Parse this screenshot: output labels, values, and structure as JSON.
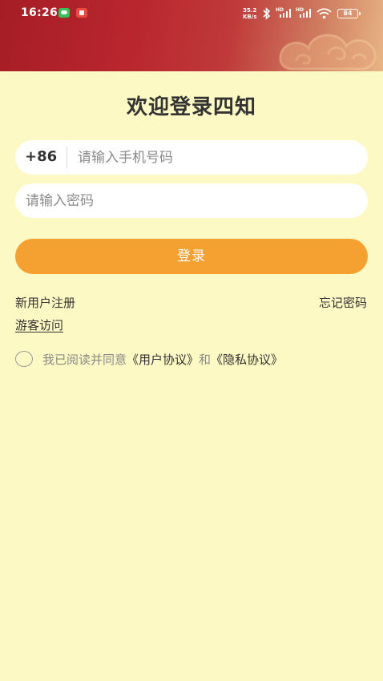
{
  "status_bar": {
    "time": "16:26",
    "net_speed_value": "35.2",
    "net_speed_unit": "KB/s",
    "signal_label": "HD",
    "battery": "84"
  },
  "login": {
    "title": "欢迎登录四知",
    "country_code": "+86",
    "phone_placeholder": "请输入手机号码",
    "password_placeholder": "请输入密码",
    "login_button": "登录",
    "register_link": "新用户注册",
    "forgot_link": "忘记密码",
    "guest_link": "游客访问",
    "agreement": {
      "prefix": "我已阅读并同意",
      "user_agreement": "《用户协议》",
      "connector": "和",
      "privacy_agreement": "《隐私协议》"
    }
  },
  "colors": {
    "background": "#fdf9c4",
    "header_red": "#b9262e",
    "accent_orange": "#f5a131"
  }
}
